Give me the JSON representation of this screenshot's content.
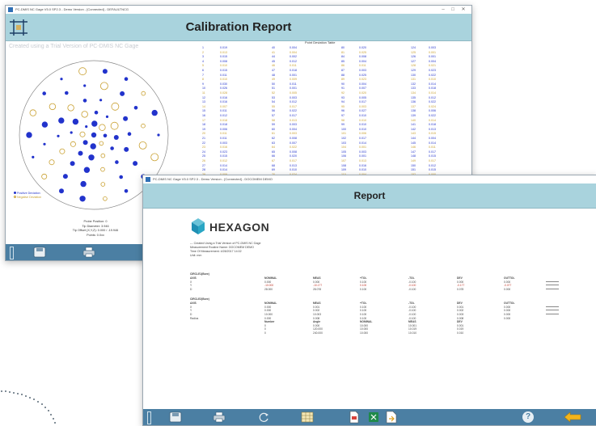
{
  "win1": {
    "title": "PC-DMIS NC Gage V5.0 SP2.3 - Demo Version - [Connected] - DEFAULTNCG",
    "header": "Calibration Report",
    "watermark": "Created using a Trial Version of PC-DMIS NC Gage",
    "table_title": "Point Deviation Table",
    "legend": [
      "Positive Deviation",
      "Negative Deviation"
    ],
    "info": [
      "Probe Position: 0",
      "Tip Diameter: 3.946",
      "Tip Offset (X,Y,Z): 0.000 / -19.946",
      "Points: 0.0xx"
    ],
    "columns": [
      {
        "ids": [
          "1",
          "2",
          "3",
          "4",
          "5",
          "6",
          "7",
          "8",
          "9",
          "10",
          "11",
          "12",
          "13",
          "14",
          "15",
          "16",
          "17",
          "18",
          "19",
          "20",
          "21",
          "22",
          "23",
          "24",
          "25",
          "26",
          "27",
          "28",
          "29",
          "30"
        ],
        "vals": [
          "0.019",
          "0.013",
          "0.015",
          "0.008",
          "0.010",
          "0.015",
          "0.011",
          "0.010",
          "0.030",
          "0.026",
          "0.028",
          "0.016",
          "0.016",
          "0.007",
          "0.011",
          "0.012",
          "0.018",
          "0.018",
          "0.006",
          "0.011",
          "0.011",
          "0.003",
          "0.016",
          "0.023",
          "0.015",
          "0.012",
          "0.014",
          "0.014",
          "0.009",
          "0.015"
        ]
      },
      {
        "ids": [
          "40",
          "41",
          "44",
          "45",
          "46",
          "47",
          "48",
          "49",
          "50",
          "51",
          "52",
          "53",
          "54",
          "55",
          "56",
          "57",
          "58",
          "59",
          "60",
          "61",
          "62",
          "63",
          "64",
          "65",
          "66",
          "67",
          "68",
          "69",
          "70",
          "71"
        ],
        "vals": [
          "0.004",
          "0.004",
          "0.002",
          "0.012",
          "0.011",
          "0.018",
          "0.001",
          "0.009",
          "0.011",
          "0.001",
          "0.005",
          "0.003",
          "0.012",
          "0.017",
          "0.022",
          "0.017",
          "0.013",
          "0.003",
          "0.004",
          "0.003",
          "0.008",
          "0.007",
          "0.022",
          "0.008",
          "0.020",
          "0.017",
          "0.013",
          "0.010",
          "0.024",
          "0.005"
        ]
      },
      {
        "ids": [
          "80",
          "81",
          "84",
          "85",
          "86",
          "87",
          "88",
          "89",
          "90",
          "91",
          "92",
          "93",
          "94",
          "95",
          "96",
          "97",
          "98",
          "99",
          "100",
          "101",
          "102",
          "103",
          "104",
          "105",
          "106",
          "107",
          "108",
          "109",
          "110",
          "111"
        ],
        "vals": [
          "0.020",
          "0.025",
          "0.008",
          "0.004",
          "0.011",
          "0.003",
          "0.025",
          "0.023",
          "0.004",
          "0.007",
          "0.020",
          "0.005",
          "0.017",
          "0.003",
          "0.027",
          "0.010",
          "0.010",
          "0.010",
          "0.010",
          "0.006",
          "0.017",
          "0.014",
          "0.001",
          "0.003",
          "0.001",
          "0.013",
          "0.016",
          "0.010",
          "0.004",
          "0.010"
        ]
      },
      {
        "ids": [
          "124",
          "125",
          "126",
          "127",
          "128",
          "129",
          "130",
          "131",
          "132",
          "133",
          "134",
          "135",
          "136",
          "137",
          "138",
          "139",
          "140",
          "141",
          "142",
          "143",
          "144",
          "145",
          "146",
          "147",
          "148",
          "149",
          "150",
          "151",
          "152",
          "153"
        ],
        "vals": [
          "0.003",
          "0.001",
          "0.001",
          "0.004",
          "0.021",
          "0.023",
          "0.022",
          "0.010",
          "0.014",
          "0.018",
          "0.014",
          "0.012",
          "0.022",
          "0.024",
          "0.006",
          "0.022",
          "0.014",
          "0.018",
          "0.013",
          "0.015",
          "0.004",
          "0.014",
          "0.011",
          "0.017",
          "0.015",
          "0.017",
          "0.012",
          "0.015",
          "0.000",
          "0.022"
        ]
      }
    ],
    "colors": {
      "positive": "#2233cc",
      "negative": "#c9a030"
    }
  },
  "win2": {
    "title": "PC-DMIS NC Gage V5.0 SP2.3 - Demo Version - [Connected] - DOCOMEM DEMO",
    "header": "Report",
    "brand": "HEXAGON",
    "meta": [
      "--- Created Using a Trial Version of PC-DMIS NC Gage",
      "Measurement Routine Name: DOCOMEM DEMO",
      "Time Of Measurement: 4/28/2017 14:02",
      "Unit: mm"
    ],
    "section1": {
      "name": "CIRCLE1(Bore)",
      "headers": [
        "AXIS",
        "NOMINAL",
        "MEAS",
        "+TOL",
        "-TOL",
        "DEV",
        "OUTTOL"
      ],
      "rows": [
        [
          "X",
          "0.000",
          "0.000",
          "0.100",
          "-0.100",
          "0.000",
          "0.000"
        ],
        [
          "Y",
          "-10.000",
          "-10.177",
          "0.100",
          "-0.100",
          "-0.177",
          "-0.077"
        ],
        [
          "D",
          "28.000",
          "28.078",
          "0.100",
          "-0.100",
          "0.078",
          "0.000"
        ]
      ]
    },
    "section2": {
      "name": "CIRCLE2(Bore)",
      "headers": [
        "AXIS",
        "NOMINAL",
        "MEAS",
        "+TOL",
        "-TOL",
        "DEV",
        "OUTTOL"
      ],
      "rows": [
        [
          "X",
          "0.000",
          "0.001",
          "0.100",
          "-0.100",
          "0.001",
          "0.000"
        ],
        [
          "Y",
          "0.000",
          "0.002",
          "0.100",
          "-0.100",
          "0.002",
          "0.000"
        ],
        [
          "D",
          "10.000",
          "10.003",
          "0.100",
          "-0.100",
          "0.003",
          "0.000"
        ],
        [
          "Radius",
          "0.000",
          "0.008",
          "0.100",
          "-0.100",
          "0.008",
          "0.000"
        ]
      ],
      "subheaders": [
        "Number",
        "Angle",
        "NOMINAL",
        "MEAS",
        "DEV"
      ],
      "subrows": [
        [
          "0",
          "0.000",
          "10.000",
          "10.001",
          "0.001"
        ],
        [
          "0",
          "120.000",
          "10.000",
          "10.019",
          "0.019"
        ],
        [
          "0",
          "240.000",
          "10.000",
          "10.010",
          "0.010"
        ]
      ]
    },
    "help": "?"
  }
}
